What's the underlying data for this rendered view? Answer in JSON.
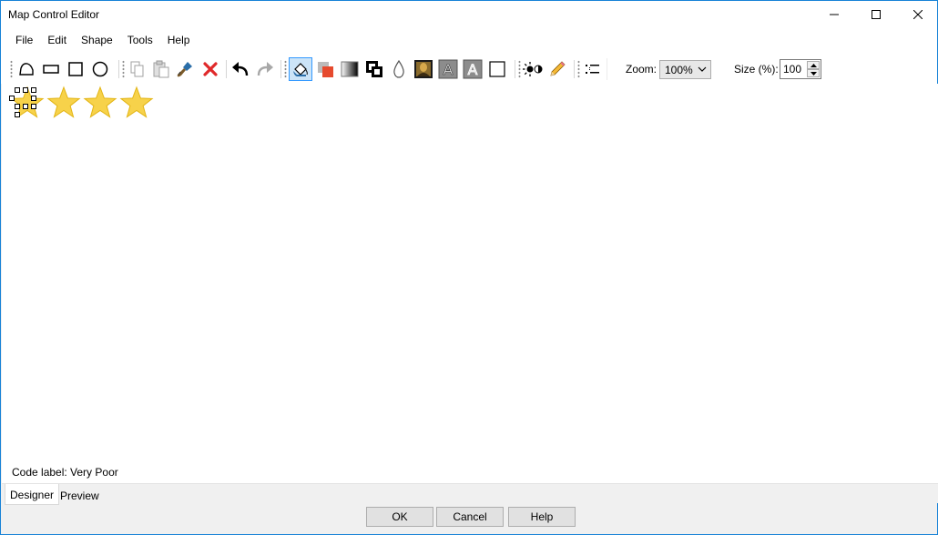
{
  "window": {
    "title": "Map Control Editor"
  },
  "menu": [
    "File",
    "Edit",
    "Shape",
    "Tools",
    "Help"
  ],
  "toolbar": {
    "zoom_label": "Zoom:",
    "zoom_value": "100%",
    "size_label": "Size (%):",
    "size_value": "100",
    "tools": [
      "polygon-tool-icon",
      "ellipse-shape-icon",
      "rectangle-tool-icon",
      "circle-tool-icon",
      "copy-icon",
      "paste-icon",
      "format-painter-icon",
      "delete-icon",
      "undo-icon",
      "redo-icon",
      "fill-icon",
      "color-icon",
      "gradient-icon",
      "bring-to-front-icon",
      "transparency-icon",
      "image-icon",
      "text-a-icon",
      "text-a-outline-icon",
      "border-icon",
      "brightness-icon",
      "pencil-icon",
      "align-icon"
    ]
  },
  "canvas": {
    "star_count": 4,
    "star_color": "#f7d24a",
    "code_label": "Code label: Very Poor"
  },
  "tabs": [
    "Designer",
    "Preview"
  ],
  "buttons": {
    "ok": "OK",
    "cancel": "Cancel",
    "help": "Help"
  }
}
